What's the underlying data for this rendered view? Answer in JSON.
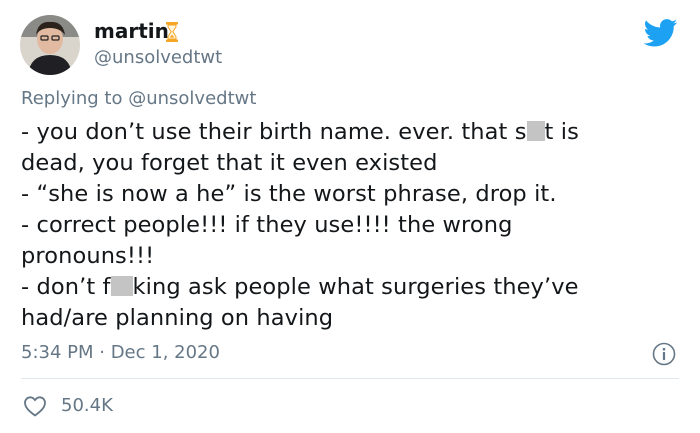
{
  "author": {
    "display_name": "martin",
    "handle": "@unsolvedtwt",
    "avatar_icon": "user-photo",
    "status_icon": "hourglass-icon"
  },
  "reply": {
    "prefix": "Replying to",
    "mention": "@unsolvedtwt"
  },
  "tweet_body": {
    "line1_a": "- you don’t use their birth name. ever. that s",
    "line1_b": "t is",
    "line2": "dead, you forget that it even existed",
    "line3": "- “she is now a he” is the worst phrase, drop it.",
    "line4": "- correct people!!! if they use!!!! the wrong",
    "line5": "pronouns!!!",
    "line6_a": "- don’t f",
    "line6_b": "king ask people what surgeries they’ve",
    "line7": "had/are planning on having"
  },
  "meta": {
    "timestamp": "5:34 PM · Dec 1, 2020"
  },
  "engagement": {
    "likes": "50.4K"
  },
  "colors": {
    "twitter_blue": "#1da1f2",
    "secondary_text": "#657786",
    "primary_text": "#14171a",
    "divider": "#e1e8ed",
    "hourglass": "#f5a623"
  }
}
